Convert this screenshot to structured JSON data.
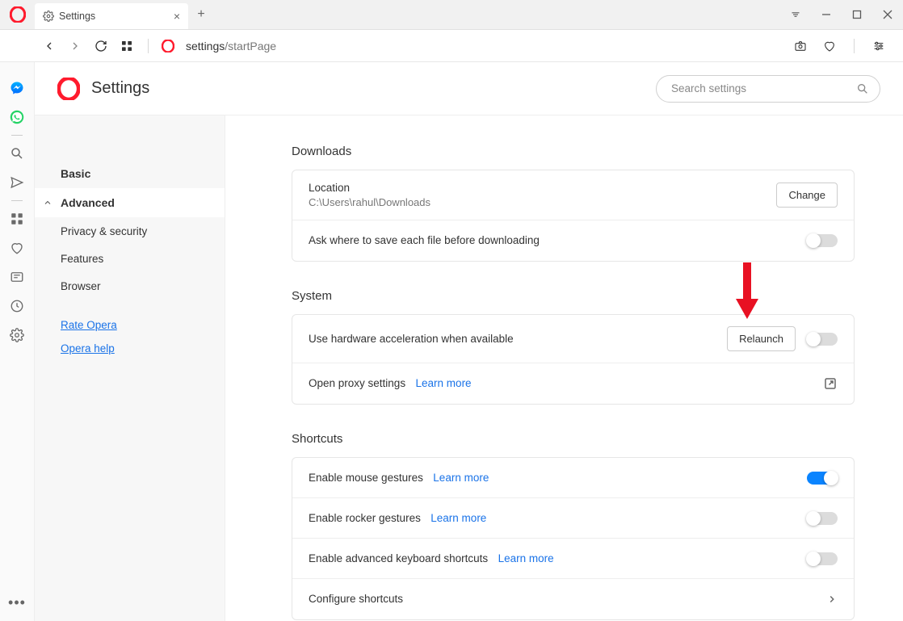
{
  "app": {
    "tab_title": "Settings",
    "address_prefix": "settings",
    "address_path": "/startPage"
  },
  "header": {
    "title": "Settings",
    "search_placeholder": "Search settings"
  },
  "sidebar": {
    "basic": "Basic",
    "advanced": "Advanced",
    "subs": [
      "Privacy & security",
      "Features",
      "Browser"
    ],
    "links": {
      "rate": "Rate Opera",
      "help": "Opera help"
    }
  },
  "sections": {
    "downloads": {
      "title": "Downloads",
      "location_label": "Location",
      "location_value": "C:\\Users\\rahul\\Downloads",
      "change_btn": "Change",
      "ask_label": "Ask where to save each file before downloading"
    },
    "system": {
      "title": "System",
      "hw_label": "Use hardware acceleration when available",
      "relaunch_btn": "Relaunch",
      "proxy_label": "Open proxy settings",
      "learn_more": "Learn more"
    },
    "shortcuts": {
      "title": "Shortcuts",
      "mouse_label": "Enable mouse gestures",
      "rocker_label": "Enable rocker gestures",
      "kbd_label": "Enable advanced keyboard shortcuts",
      "learn_more": "Learn more",
      "configure_label": "Configure shortcuts"
    }
  },
  "toggles": {
    "ask_save": false,
    "hw_accel": false,
    "mouse_gestures": true,
    "rocker_gestures": false,
    "kbd_shortcuts": false
  }
}
